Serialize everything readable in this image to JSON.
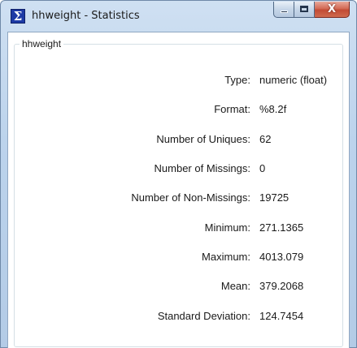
{
  "window": {
    "title": "hhweight - Statistics",
    "icon": "sigma-icon",
    "icon_glyph": "Σ",
    "close_glyph": "X"
  },
  "group": {
    "label": "hhweight"
  },
  "stats": [
    {
      "label": "Type:",
      "value": "numeric (float)"
    },
    {
      "label": "Format:",
      "value": "%8.2f"
    },
    {
      "label": "Number of Uniques:",
      "value": "62"
    },
    {
      "label": "Number of Missings:",
      "value": "0"
    },
    {
      "label": "Number of Non-Missings:",
      "value": "19725"
    },
    {
      "label": "Minimum:",
      "value": "271.1365"
    },
    {
      "label": "Maximum:",
      "value": "4013.079"
    },
    {
      "label": "Mean:",
      "value": "379.2068"
    },
    {
      "label": "Standard Deviation:",
      "value": "124.7454"
    }
  ],
  "colors": {
    "titlebar": "#bcd3ec",
    "close_button": "#c24b34",
    "icon_bg": "#1d3aa5"
  }
}
